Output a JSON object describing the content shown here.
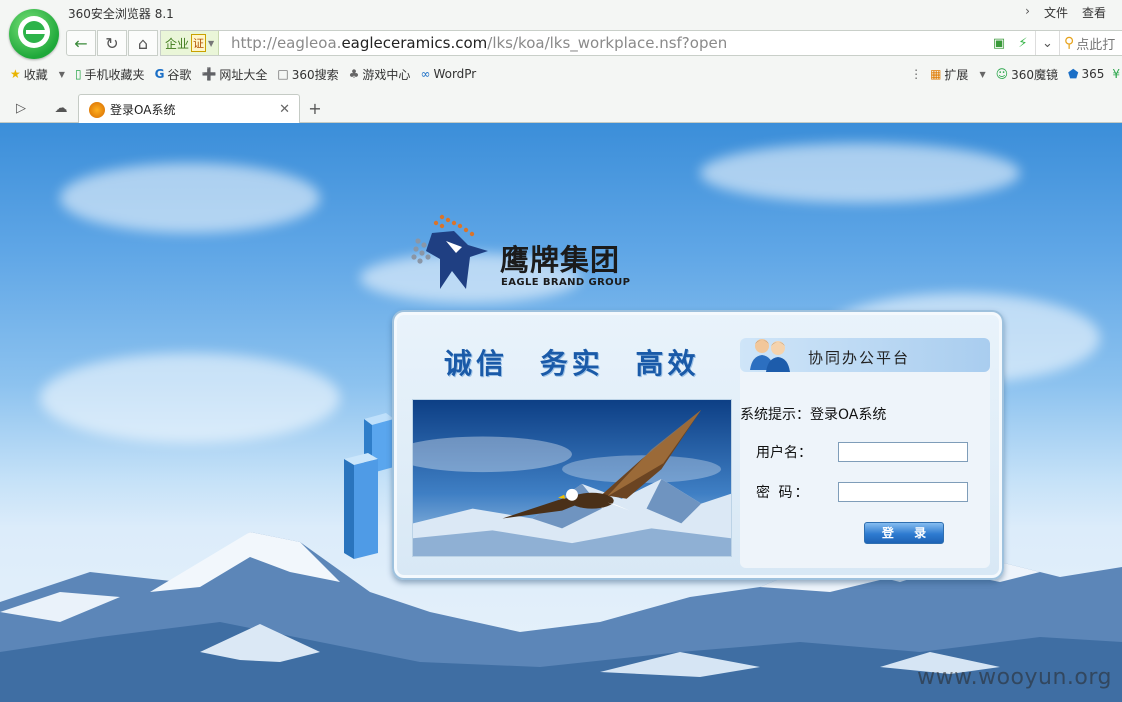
{
  "browser": {
    "app_title": "360安全浏览器 8.1",
    "menu": [
      "文件",
      "查看"
    ],
    "address": {
      "ev_label": "企业",
      "cert_label": "证",
      "url_prefix": "http://eagleoa.",
      "url_domain": "eagleceramics.com",
      "url_path": "/lks/koa/lks_workplace.nsf?open",
      "search_placeholder": "点此打"
    },
    "bookmarks": [
      {
        "label": "收藏",
        "icon": "star-icon"
      },
      {
        "label": "手机收藏夹",
        "icon": "phone-icon"
      },
      {
        "label": "谷歌",
        "icon": "google-icon"
      },
      {
        "label": "网址大全",
        "icon": "plus-circle-icon"
      },
      {
        "label": "360搜索",
        "icon": "page-icon"
      },
      {
        "label": "游戏中心",
        "icon": "gamepad-icon"
      },
      {
        "label": "WordPr",
        "icon": "wordpress-icon"
      }
    ],
    "bookmarks_right": [
      {
        "label": "扩展",
        "icon": "grid-icon"
      },
      {
        "label": "360魔镜",
        "icon": "mirror-icon"
      },
      {
        "label": "365",
        "icon": "shield-icon"
      }
    ],
    "tab": {
      "title": "登录OA系统"
    }
  },
  "page": {
    "brand_cn": "鹰牌集团",
    "brand_en": "EAGLE BRAND GROUP",
    "slogan": "诚信 务实 高效",
    "platform_title": "协同办公平台",
    "hint": "系统提示：登录OA系统",
    "username_label": "用户名：",
    "password_label": "密  码：",
    "login_button": "登 录",
    "watermark": "www.wooyun.org"
  }
}
